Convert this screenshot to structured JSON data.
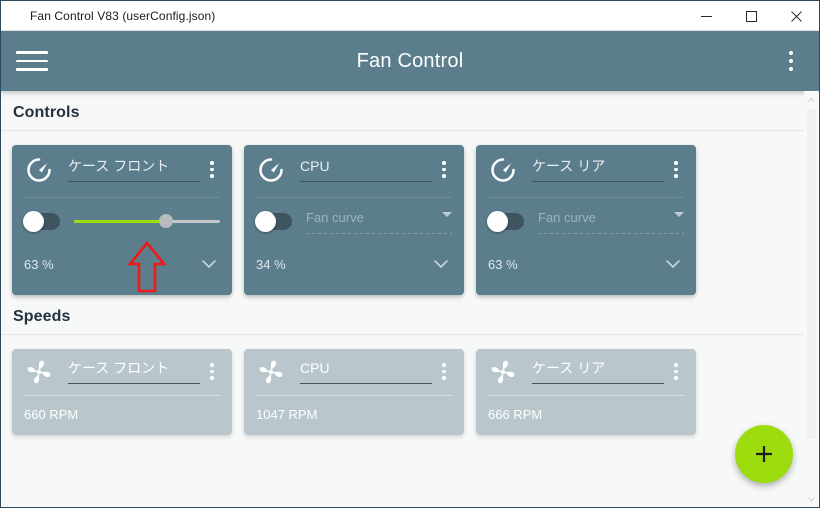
{
  "window": {
    "title": "Fan Control V83 (userConfig.json)",
    "minimize_label": "Minimize",
    "maximize_label": "Maximize",
    "close_label": "Close"
  },
  "appbar": {
    "title": "Fan Control",
    "menu_label": "Menu",
    "overflow_label": "More options"
  },
  "colors": {
    "card": "#5b7d8c",
    "appbar": "#5b7d8c",
    "speed_card": "#b9c7cd",
    "accent_green": "#9ddc0c",
    "slider_fill": "#9ede0c",
    "annotation_red": "#f01818",
    "page_bg": "#f7f8f8"
  },
  "sections": {
    "controls": {
      "title": "Controls",
      "cards": [
        {
          "icon": "gauge-icon",
          "name": "ケース フロント",
          "mode": "slider",
          "toggle_state": "off",
          "slider_percent": 63,
          "value": "63 %",
          "menu_label": "Card menu",
          "expand_label": "Expand"
        },
        {
          "icon": "gauge-icon",
          "name": "CPU",
          "mode": "curve",
          "toggle_state": "off",
          "curve_placeholder": "Fan curve",
          "value": "34 %",
          "menu_label": "Card menu",
          "expand_label": "Expand"
        },
        {
          "icon": "gauge-icon",
          "name": "ケース リア",
          "mode": "curve",
          "toggle_state": "off",
          "curve_placeholder": "Fan curve",
          "value": "63 %",
          "menu_label": "Card menu",
          "expand_label": "Expand"
        }
      ]
    },
    "speeds": {
      "title": "Speeds",
      "cards": [
        {
          "icon": "fan-icon",
          "name": "ケース フロント",
          "value": "660 RPM",
          "menu_label": "Card menu"
        },
        {
          "icon": "fan-icon",
          "name": "CPU",
          "value": "1047 RPM",
          "menu_label": "Card menu"
        },
        {
          "icon": "fan-icon",
          "name": "ケース リア",
          "value": "666 RPM",
          "menu_label": "Card menu"
        }
      ]
    }
  },
  "fab": {
    "icon": "plus-icon",
    "label": "Add"
  },
  "annotation": {
    "shape": "arrow-up-icon",
    "points_at": "slider-thumb"
  },
  "scrollbar": {
    "up_icon": "chevron-up-icon",
    "down_icon": "chevron-down-icon"
  }
}
